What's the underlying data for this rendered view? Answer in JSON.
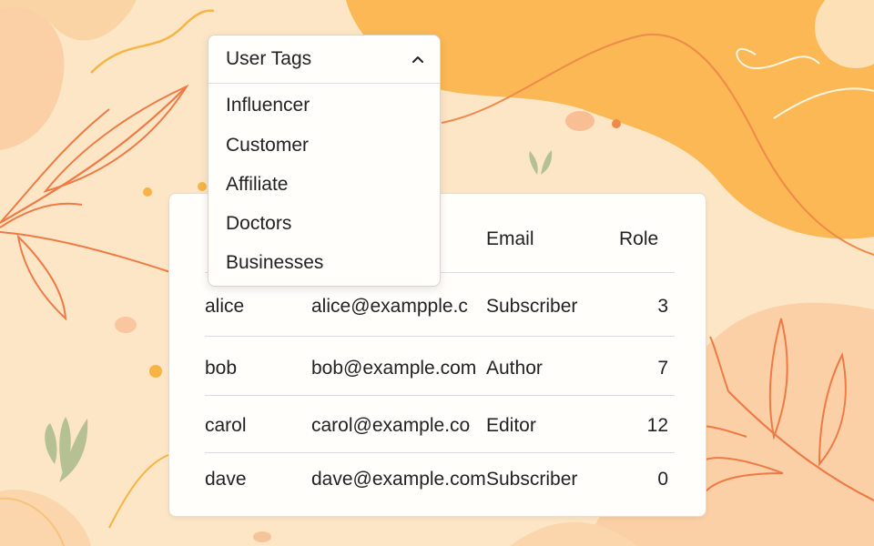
{
  "dropdown": {
    "title": "User Tags",
    "expanded": true,
    "options": [
      "Influencer",
      "Customer",
      "Affiliate",
      "Doctors",
      "Businesses"
    ]
  },
  "table": {
    "headers": [
      "",
      "",
      "Email",
      "Role"
    ],
    "rows": [
      {
        "name": "alice",
        "email": "alice@exampple.c",
        "role": "Subscriber",
        "count": "3"
      },
      {
        "name": "bob",
        "email": "bob@example.com",
        "role": "Author",
        "count": "7"
      },
      {
        "name": "carol",
        "email": "carol@example.co",
        "role": "Editor",
        "count": "12"
      },
      {
        "name": "dave",
        "email": "dave@example.com",
        "role": "Subscriber",
        "count": "0"
      }
    ]
  },
  "colors": {
    "accent_orange": "#f9b751",
    "leaf_line": "#f07a45",
    "background": "#fde6c6"
  }
}
